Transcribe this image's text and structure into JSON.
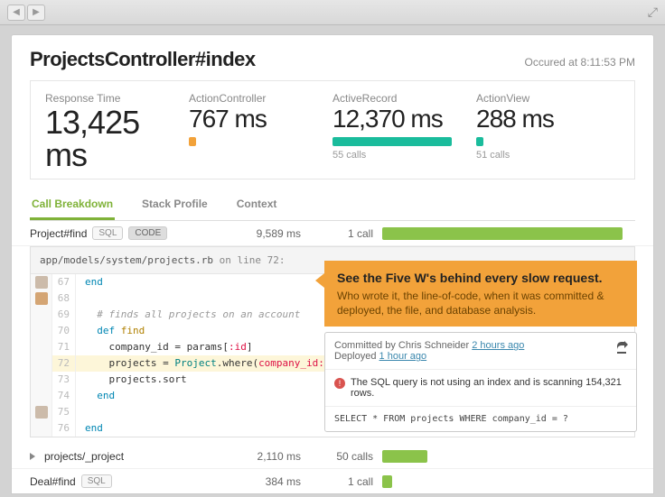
{
  "header": {
    "title": "ProjectsController#index",
    "occurred_prefix": "Occured at ",
    "occurred_time": "8:11:53 PM"
  },
  "metrics": {
    "response_time": {
      "label": "Response Time",
      "value": "13,425 ms"
    },
    "action_controller": {
      "label": "ActionController",
      "value": "767 ms"
    },
    "active_record": {
      "label": "ActiveRecord",
      "value": "12,370 ms",
      "calls": "55 calls"
    },
    "action_view": {
      "label": "ActionView",
      "value": "288 ms",
      "calls": "51 calls"
    }
  },
  "tabs": {
    "breakdown": "Call Breakdown",
    "stack": "Stack Profile",
    "context": "Context"
  },
  "rows": [
    {
      "name": "Project#find",
      "tags": [
        "SQL",
        "CODE"
      ],
      "time": "9,589 ms",
      "calls": "1 call",
      "bar_pct": 95
    },
    {
      "name": "projects/_project",
      "tags": [],
      "time": "2,110 ms",
      "calls": "50 calls",
      "bar_pct": 18
    },
    {
      "name": "Deal#find",
      "tags": [
        "SQL"
      ],
      "time": "384 ms",
      "calls": "1 call",
      "bar_pct": 4
    }
  ],
  "code": {
    "path": "app/models/system/projects.rb",
    "on_line_label": " on line ",
    "on_line": "72",
    "lines": [
      {
        "n": 67,
        "avatar": "a",
        "html": "<span class='kw'>end</span>"
      },
      {
        "n": 68,
        "avatar": "b",
        "html": ""
      },
      {
        "n": 69,
        "avatar": "",
        "html": "  <span class='com'># finds all projects on an account</span>"
      },
      {
        "n": 70,
        "avatar": "",
        "html": "  <span class='kw'>def</span> <span class='def'>find</span>"
      },
      {
        "n": 71,
        "avatar": "",
        "html": "    company_id = params[<span class='sym'>:id</span>]"
      },
      {
        "n": 72,
        "avatar": "",
        "html": "    projects = <span class='const'>Project</span>.where(<span class='sym'>company_id:</span> company_id)",
        "hl": true
      },
      {
        "n": 73,
        "avatar": "",
        "html": "    projects.sort"
      },
      {
        "n": 74,
        "avatar": "",
        "html": "  <span class='kw'>end</span>"
      },
      {
        "n": 75,
        "avatar": "a",
        "html": ""
      },
      {
        "n": 76,
        "avatar": "",
        "html": "<span class='kw'>end</span>"
      }
    ]
  },
  "callout": {
    "title": "See the Five W's behind every slow request.",
    "sub": "Who wrote it, the line-of-code, when it was committed & deployed, the file, and database analysis."
  },
  "commit": {
    "by_prefix": "Committed by ",
    "author": "Chris Schneider",
    "committed_link": "2 hours ago",
    "deployed_prefix": "Deployed ",
    "deployed_link": "1 hour ago",
    "warning": "The SQL query is not using an index and is scanning 154,321 rows.",
    "sql": "SELECT * FROM projects WHERE company_id = ?"
  }
}
